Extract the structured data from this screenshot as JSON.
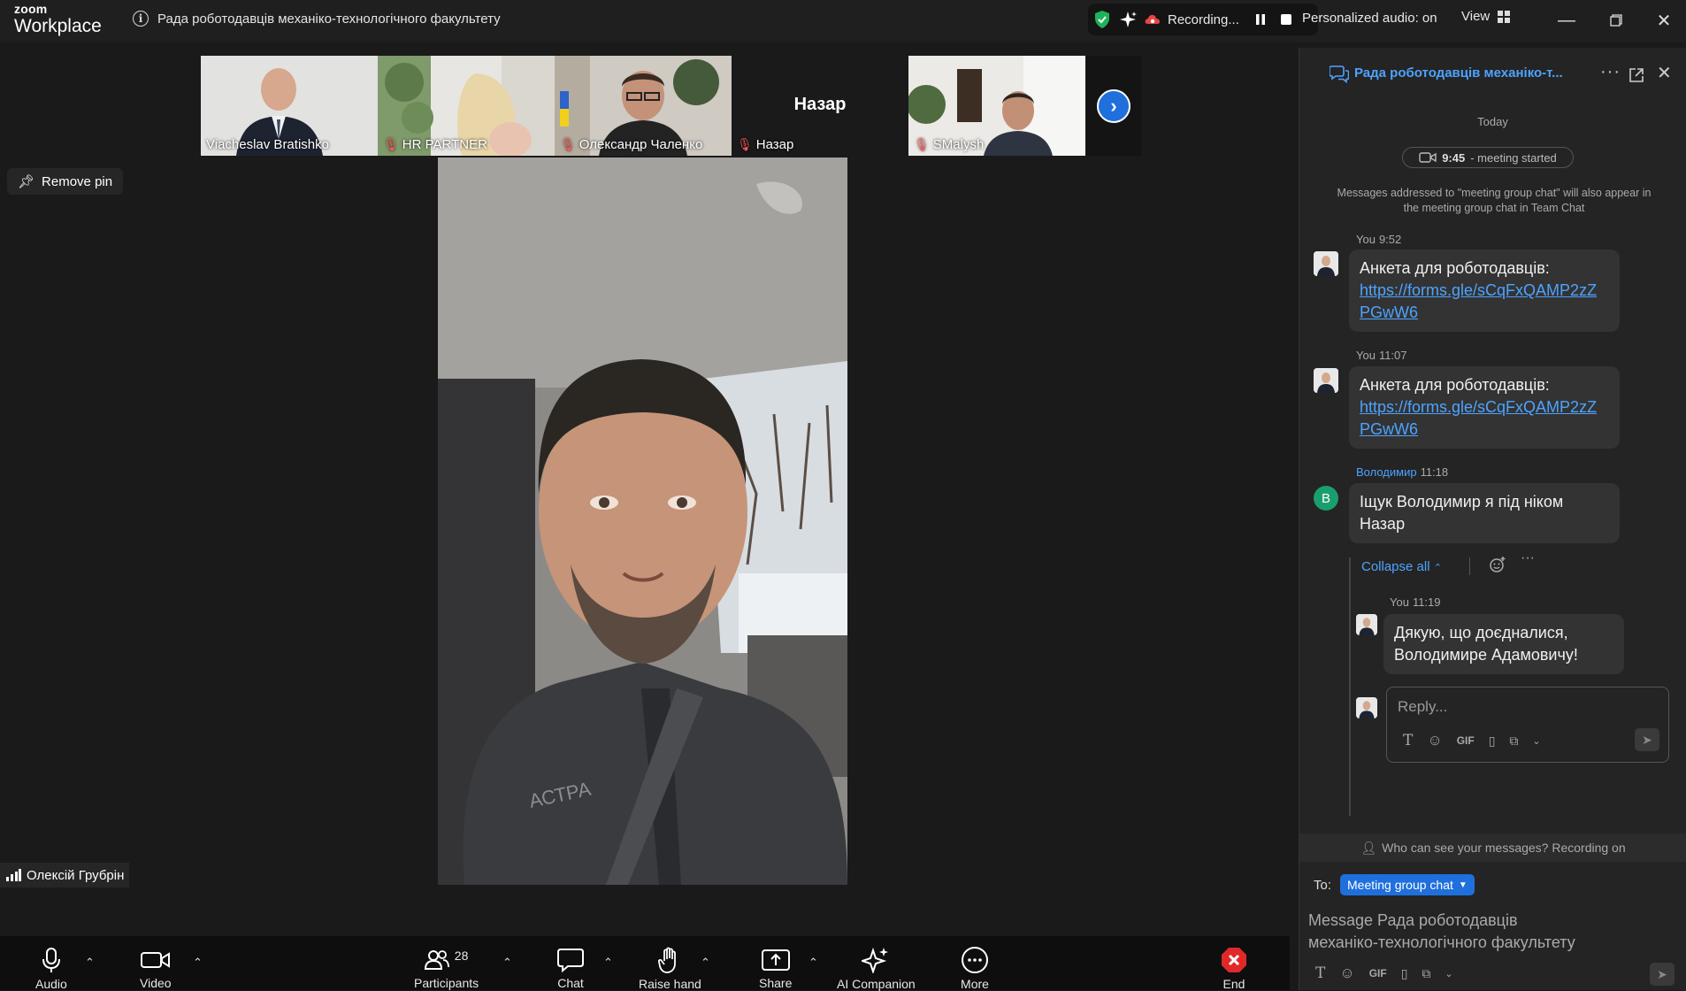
{
  "app": {
    "brand_top": "zoom",
    "brand_bottom": "Workplace",
    "meeting_title": "Рада роботодавців механіко-технологічного факультету",
    "recording_label": "Recording...",
    "personalized_audio": "Personalized audio: on",
    "view_label": "View"
  },
  "filmstrip": {
    "tiles": [
      {
        "name": "Viachesl av Bratishko",
        "display": "Viacheslav Bratishko",
        "muted": false
      },
      {
        "name": "HR PARTNER",
        "display": "HR PARTNER",
        "muted": true
      },
      {
        "name": "Олександр Чаленко",
        "display": "Олександр Чаленко",
        "muted": true
      },
      {
        "name": "Назар",
        "display": "Назар",
        "muted": true,
        "big_name": "Назар"
      },
      {
        "name": "SMalysh",
        "display": "SMalysh",
        "muted": true
      }
    ]
  },
  "pin": {
    "label": "Remove pin"
  },
  "active_speaker": {
    "name": "Олексій Грубрін"
  },
  "toolbar": {
    "audio": "Audio",
    "video": "Video",
    "participants": "Participants",
    "participants_count": "28",
    "chat": "Chat",
    "raise_hand": "Raise hand",
    "share": "Share",
    "ai_companion": "AI Companion",
    "more": "More",
    "end": "End"
  },
  "chat": {
    "title": "Рада роботодавців механіко-т...",
    "today": "Today",
    "meeting_started_time": "9:45",
    "meeting_started_text": "- meeting started",
    "note": "Messages addressed to \"meeting group chat\" will also appear in the meeting group chat in Team Chat",
    "messages": [
      {
        "sender": "You",
        "time": "9:52",
        "text": "Анкета для роботодавців:",
        "link_line1": "https://forms.gle/sCqFxQAMP2zZ",
        "link_line2": "PGwW6"
      },
      {
        "sender": "You",
        "time": "11:07",
        "text": "Анкета для роботодавців:",
        "link_line1": "https://forms.gle/sCqFxQAMP2zZ",
        "link_line2": "PGwW6"
      },
      {
        "sender": "Володимир",
        "time": "11:18",
        "avatar_letter": "В",
        "line1": "Іщук Володимир я під ніком",
        "line2": "Назар"
      }
    ],
    "collapse_label": "Collapse all",
    "reply": {
      "sender": "You",
      "time": "11:19",
      "line1": "Дякую, що доєдналися,",
      "line2": "Володимире Адамовичу!"
    },
    "reply_placeholder": "Reply...",
    "gif": "GIF",
    "who_can_see": "Who can see your messages? Recording on",
    "to_label": "To:",
    "to_target": "Meeting group chat",
    "compose_line1": "Message Рада роботодавців",
    "compose_line2": "механіко-технологічного факультету"
  },
  "colors": {
    "accent": "#1f6fdc",
    "link": "#4da3ff",
    "end_red": "#e02828",
    "record_red": "#e84545",
    "shield_green": "#20b25a"
  }
}
